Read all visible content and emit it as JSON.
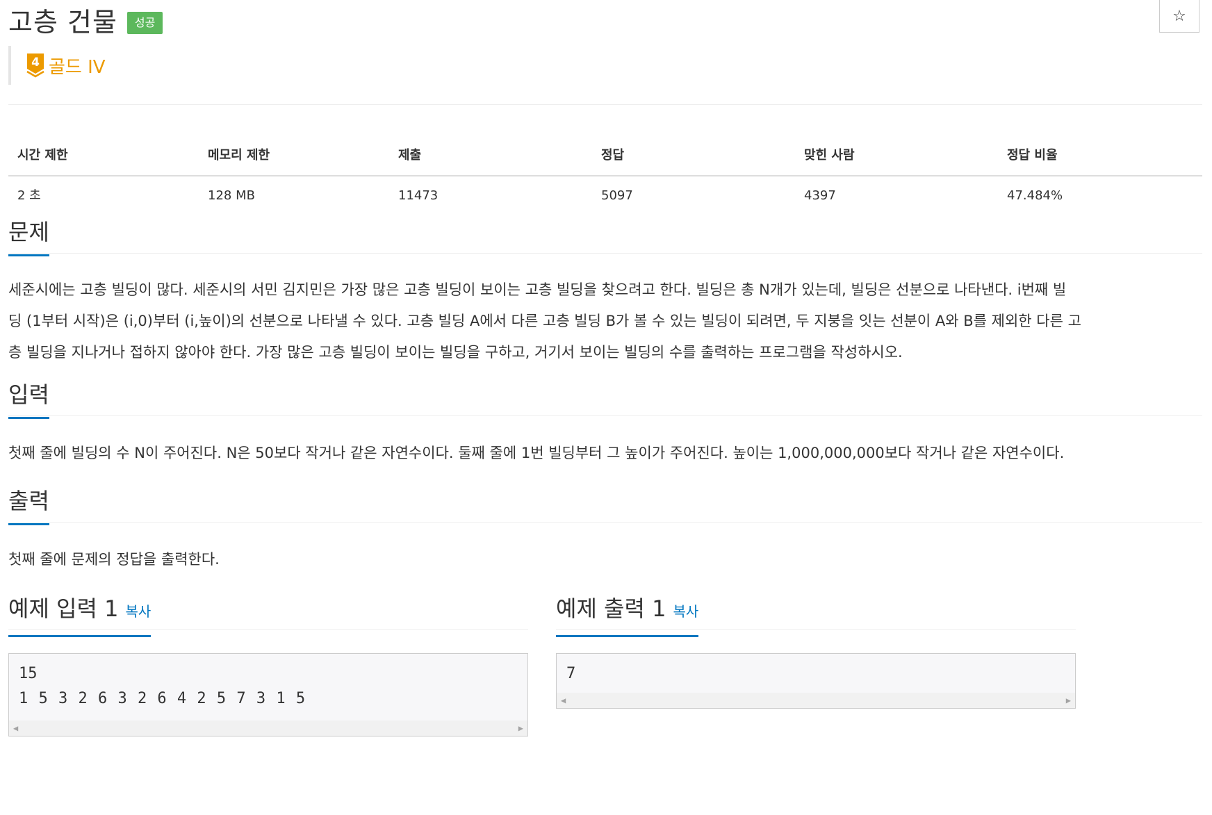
{
  "problem": {
    "title": "고층 건물",
    "result_badge": "성공",
    "star_symbol": "☆",
    "tier": {
      "level": "4",
      "label": "골드 IV",
      "color": "#ec9a00"
    }
  },
  "info_table": {
    "headers": [
      "시간 제한",
      "메모리 제한",
      "제출",
      "정답",
      "맞힌 사람",
      "정답 비율"
    ],
    "values": [
      "2 초",
      "128 MB",
      "11473",
      "5097",
      "4397",
      "47.484%"
    ]
  },
  "sections": {
    "description": {
      "title": "문제",
      "lines": [
        "세준시에는 고층 빌딩이 많다. 세준시의 서민 김지민은 가장 많은 고층 빌딩이 보이는 고층 빌딩을 찾으려고 한다. 빌딩은 총 N개가 있는데, 빌딩은 선분으로 나타낸다. i번째 빌",
        "딩 (1부터 시작)은 (i,0)부터 (i,높이)의 선분으로 나타낼 수 있다. 고층 빌딩 A에서 다른 고층 빌딩 B가 볼 수 있는 빌딩이 되려면, 두 지붕을 잇는 선분이 A와 B를 제외한 다른 고",
        "층 빌딩을 지나거나 접하지 않아야 한다. 가장 많은 고층 빌딩이 보이는 빌딩을 구하고, 거기서 보이는 빌딩의 수를 출력하는 프로그램을 작성하시오."
      ]
    },
    "input": {
      "title": "입력",
      "text": "첫째 줄에 빌딩의 수 N이 주어진다. N은 50보다 작거나 같은 자연수이다. 둘째 줄에 1번 빌딩부터 그 높이가 주어진다. 높이는 1,000,000,000보다 작거나 같은 자연수이다."
    },
    "output": {
      "title": "출력",
      "text": "첫째 줄에 문제의 정답을 출력한다."
    }
  },
  "samples": {
    "input": {
      "title": "예제 입력 1",
      "copy_label": "복사",
      "lines": [
        "15",
        "1 5 3 2 6 3 2 6 4 2 5 7 3 1 5"
      ]
    },
    "output": {
      "title": "예제 출력 1",
      "copy_label": "복사",
      "lines": [
        "7"
      ]
    }
  },
  "colors": {
    "accent": "#0076c0",
    "success": "#5cb85c",
    "gold": "#ec9a00"
  }
}
